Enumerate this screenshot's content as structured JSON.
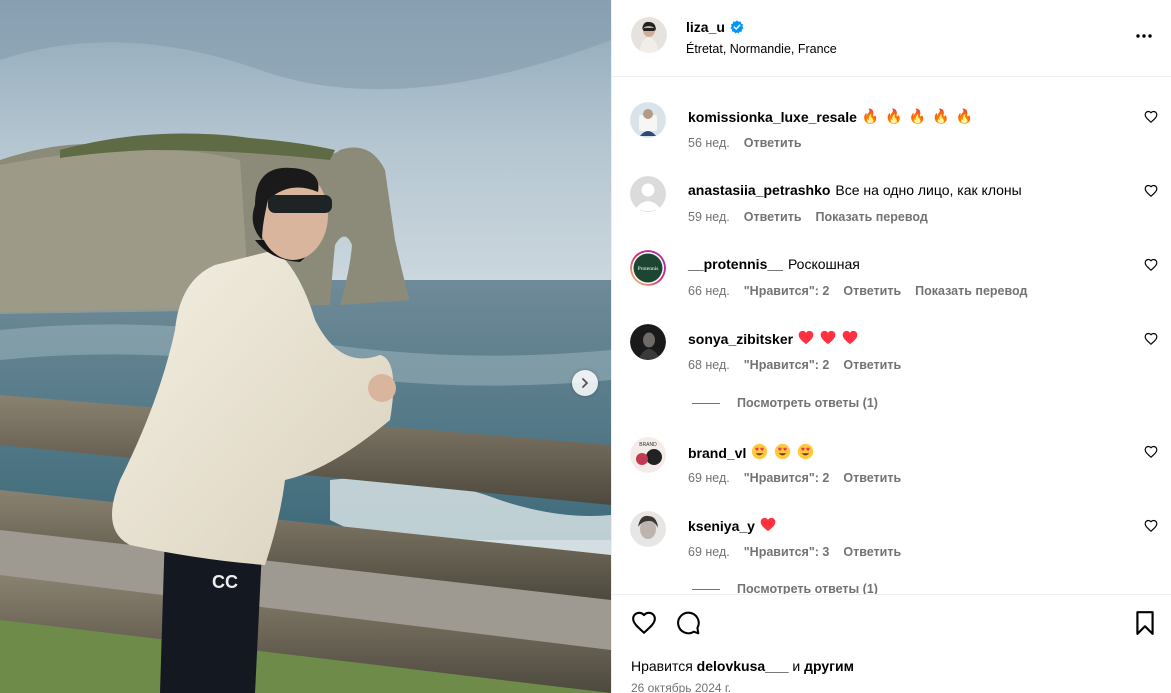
{
  "post": {
    "username": "liza_u",
    "verified": true,
    "location": "Étretat, Normandie, France"
  },
  "comments": [
    {
      "user": "komissionka_luxe_resale",
      "text": "",
      "emoji": [
        "fire",
        "fire",
        "fire",
        "fire",
        "fire"
      ],
      "age": "56 нед.",
      "likes": "",
      "reply": "Ответить",
      "translate": ""
    },
    {
      "user": "anastasiia_petrashko",
      "text": "Все на одно лицо, как клоны",
      "emoji": [],
      "age": "59 нед.",
      "likes": "",
      "reply": "Ответить",
      "translate": "Показать перевод"
    },
    {
      "user": "__protennis__",
      "text": "Роскошная",
      "emoji": [],
      "age": "66 нед.",
      "likes": "\"Нравится\": 2",
      "reply": "Ответить",
      "translate": "Показать перевод",
      "avatar_text": "Protennis"
    },
    {
      "user": "sonya_zibitsker",
      "text": "",
      "emoji": [
        "heart",
        "heart",
        "heart"
      ],
      "age": "68 нед.",
      "likes": "\"Нравится\": 2",
      "reply": "Ответить",
      "translate": ""
    },
    {
      "user": "brand_vl",
      "text": "",
      "emoji": [
        "heart-eyes",
        "heart-eyes",
        "heart-eyes"
      ],
      "age": "69 нед.",
      "likes": "\"Нравится\": 2",
      "reply": "Ответить",
      "translate": ""
    },
    {
      "user": "kseniya_y",
      "text": "",
      "emoji": [
        "heart"
      ],
      "age": "69 нед.",
      "likes": "\"Нравится\": 3",
      "reply": "Ответить",
      "translate": ""
    }
  ],
  "view_replies": [
    "Посмотреть ответы (1)",
    "Посмотреть ответы (1)"
  ],
  "footer": {
    "likes_prefix": "Нравится",
    "likes_user": "delovkusa___",
    "likes_and": "и",
    "likes_others": "другим",
    "date": "26 октябрь 2024 г."
  },
  "colors": {
    "verified": "#0095f6",
    "muted": "#737373",
    "divider": "#efefef",
    "fire": "#e8571c",
    "heart": "#ff3040"
  },
  "icons": [
    "verified-icon",
    "more-icon",
    "next-arrow-icon",
    "heart-icon",
    "comment-icon",
    "bookmark-icon",
    "small-heart-icon"
  ]
}
